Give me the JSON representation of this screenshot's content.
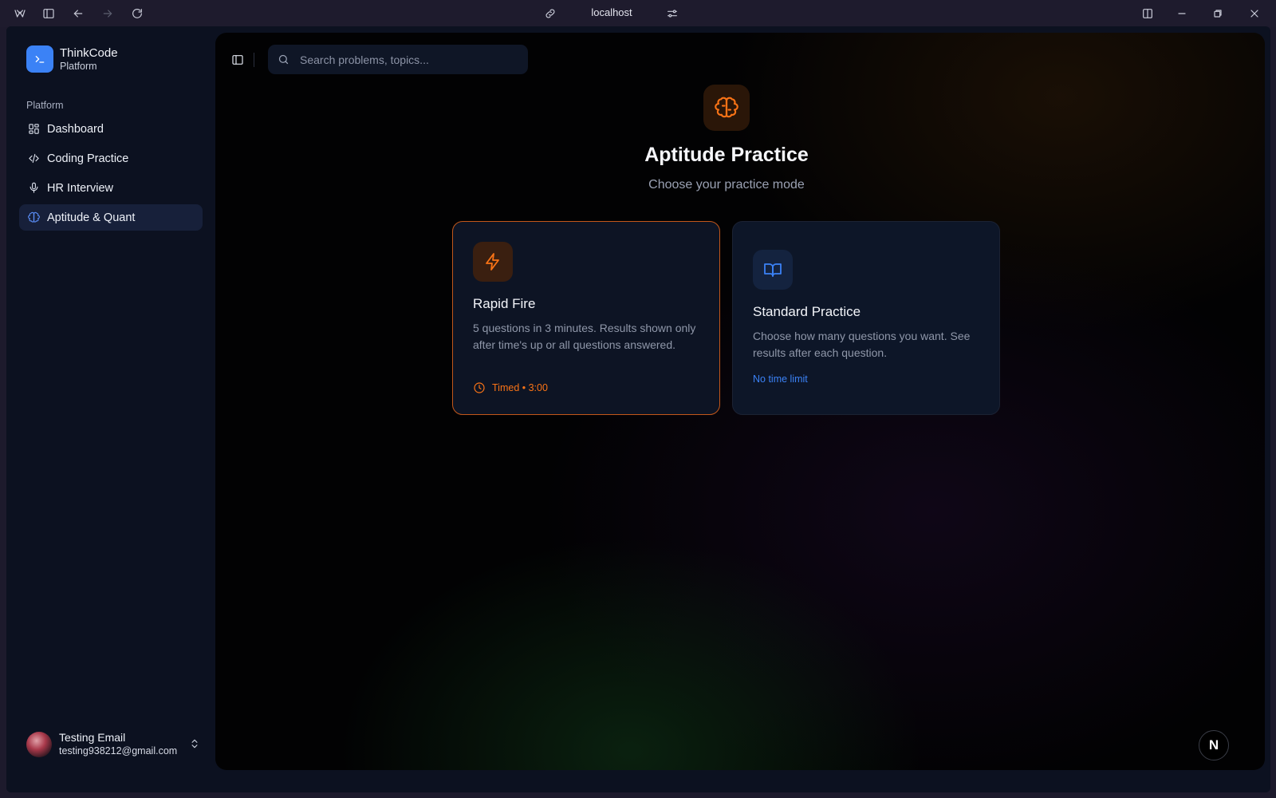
{
  "browser": {
    "url": "localhost"
  },
  "sidebar": {
    "brand_name": "ThinkCode",
    "brand_sub": "Platform",
    "section_label": "Platform",
    "items": [
      {
        "label": "Dashboard",
        "icon": "layout-dashboard-icon"
      },
      {
        "label": "Coding Practice",
        "icon": "code-icon"
      },
      {
        "label": "HR Interview",
        "icon": "mic-icon"
      },
      {
        "label": "Aptitude & Quant",
        "icon": "brain-icon",
        "active": true
      }
    ],
    "user": {
      "name": "Testing Email",
      "email": "testing938212@gmail.com"
    }
  },
  "main": {
    "search_placeholder": "Search problems, topics...",
    "title": "Aptitude Practice",
    "subtitle": "Choose your practice mode",
    "cards": [
      {
        "title": "Rapid Fire",
        "description": "5 questions in 3 minutes. Results shown only after time's up or all questions answered.",
        "meta": "Timed • 3:00",
        "icon": "zap-icon",
        "accent": "#f97316"
      },
      {
        "title": "Standard Practice",
        "description": "Choose how many questions you want. See results after each question.",
        "meta": "No time limit",
        "icon": "book-open-icon",
        "accent": "#3b82f6"
      }
    ],
    "badge": "N"
  },
  "colors": {
    "accent_orange": "#f97316",
    "accent_blue": "#3b82f6",
    "sidebar_bg": "#0c1120"
  }
}
